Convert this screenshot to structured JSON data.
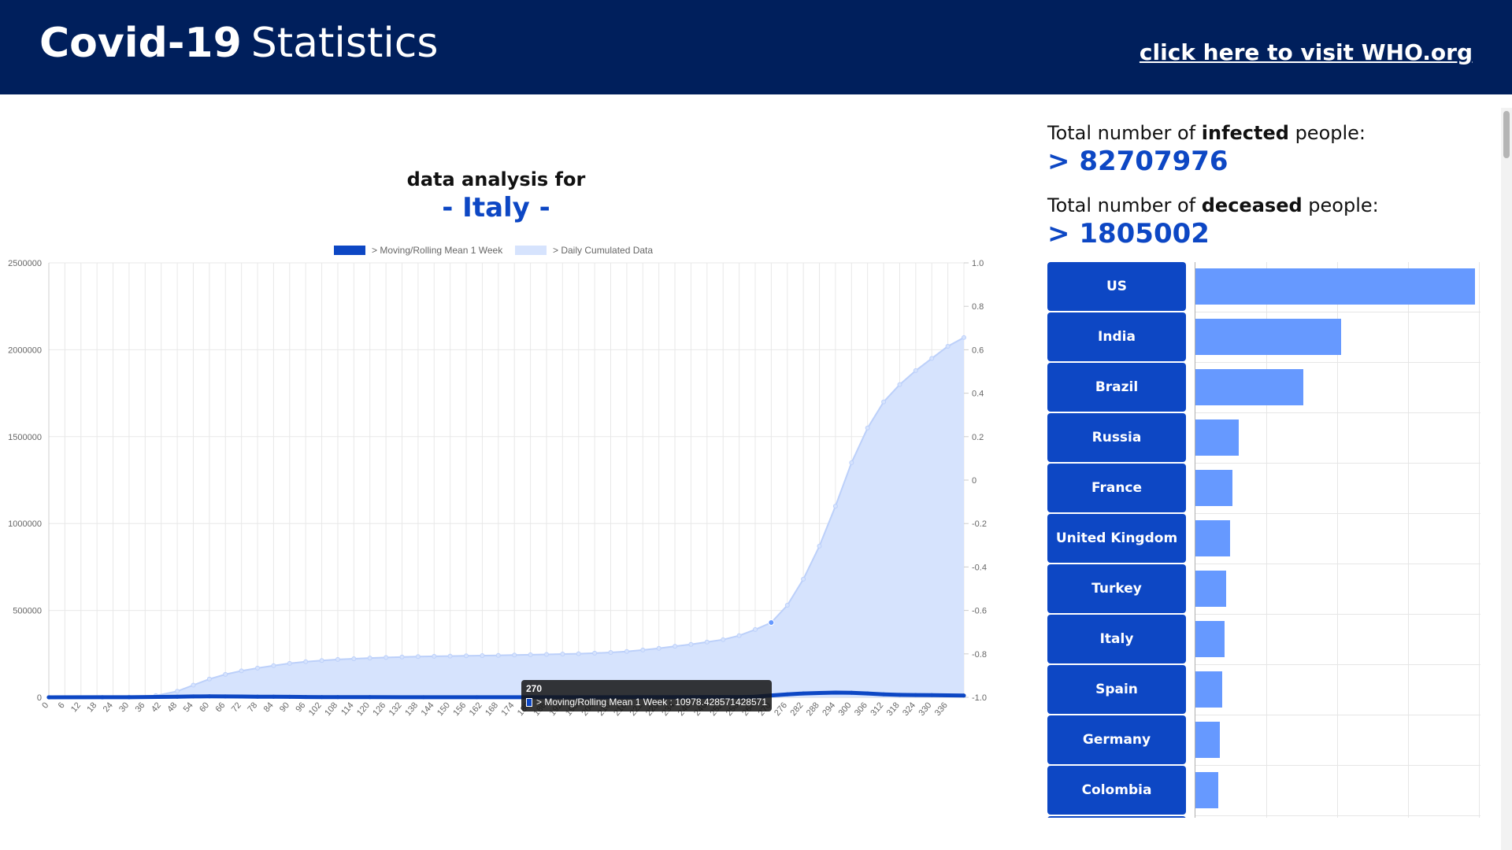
{
  "header": {
    "title_bold": "Covid-19",
    "title_light": "Statistics",
    "who_link": "click here to visit WHO.org"
  },
  "chart": {
    "heading": "data analysis for",
    "country": "- Italy -"
  },
  "stats": {
    "infected_prefix": "Total number of ",
    "infected_bold": "infected",
    "infected_suffix": " people:",
    "infected_value": "> 82707976",
    "deceased_prefix": "Total number of ",
    "deceased_bold": "deceased",
    "deceased_suffix": " people:",
    "deceased_value": "> 1805002"
  },
  "tooltip": {
    "title": "270",
    "label": "> Moving/Rolling Mean 1 Week : 10978.428571428571"
  },
  "colors": {
    "header_bg": "#001f5c",
    "accent": "#0d47c4",
    "area_fill": "#d6e3fd",
    "area_line": "#bcd0fa",
    "bar": "#6699ff"
  },
  "ranking": {
    "countries": [
      "US",
      "India",
      "Brazil",
      "Russia",
      "France",
      "United Kingdom",
      "Turkey",
      "Italy",
      "Spain",
      "Germany",
      "Colombia"
    ],
    "relative_values": [
      1.0,
      0.52,
      0.385,
      0.155,
      0.133,
      0.123,
      0.11,
      0.104,
      0.096,
      0.088,
      0.082
    ]
  },
  "chart_data": {
    "type": "line",
    "title": "data analysis for - Italy -",
    "legend": [
      "> Moving/Rolling Mean 1 Week",
      "> Daily Cumulated Data"
    ],
    "legend_position": "top",
    "xlabel": "",
    "ylabel": "",
    "ylim": [
      0,
      2500000
    ],
    "y_ticks": [
      "0",
      "500000",
      "1000000",
      "1500000",
      "2000000",
      "2500000"
    ],
    "y2_ticks": [
      "-1.0",
      "-0.8",
      "-0.6",
      "-0.4",
      "-0.2",
      "0",
      "0.2",
      "0.4",
      "0.6",
      "0.8",
      "1.0"
    ],
    "x_ticks": [
      "0",
      "6",
      "12",
      "18",
      "24",
      "30",
      "36",
      "42",
      "48",
      "54",
      "60",
      "66",
      "72",
      "78",
      "84",
      "90",
      "96",
      "102",
      "108",
      "114",
      "120",
      "126",
      "132",
      "138",
      "144",
      "150",
      "156",
      "162",
      "168",
      "174",
      "180",
      "186",
      "192",
      "198",
      "204",
      "210",
      "216",
      "222",
      "228",
      "234",
      "240",
      "246",
      "252",
      "258",
      "264",
      "270",
      "276",
      "282",
      "288",
      "294",
      "300",
      "306",
      "312",
      "318",
      "324",
      "330",
      "336"
    ],
    "xmax": 342,
    "grid": true,
    "series": [
      {
        "name": "> Daily Cumulated Data",
        "points": [
          [
            0,
            0
          ],
          [
            20,
            10
          ],
          [
            30,
            1500
          ],
          [
            40,
            10000
          ],
          [
            48,
            35000
          ],
          [
            54,
            70000
          ],
          [
            60,
            105000
          ],
          [
            66,
            132000
          ],
          [
            72,
            152000
          ],
          [
            78,
            168000
          ],
          [
            84,
            182000
          ],
          [
            90,
            195000
          ],
          [
            96,
            205000
          ],
          [
            102,
            212000
          ],
          [
            108,
            218000
          ],
          [
            114,
            222000
          ],
          [
            120,
            226000
          ],
          [
            126,
            229000
          ],
          [
            132,
            232000
          ],
          [
            138,
            234000
          ],
          [
            144,
            236000
          ],
          [
            150,
            237500
          ],
          [
            156,
            239000
          ],
          [
            162,
            240000
          ],
          [
            168,
            241500
          ],
          [
            174,
            243000
          ],
          [
            180,
            245000
          ],
          [
            186,
            247000
          ],
          [
            192,
            249000
          ],
          [
            198,
            251000
          ],
          [
            204,
            254000
          ],
          [
            210,
            258000
          ],
          [
            216,
            264000
          ],
          [
            222,
            272000
          ],
          [
            228,
            282000
          ],
          [
            234,
            294000
          ],
          [
            240,
            305000
          ],
          [
            246,
            318000
          ],
          [
            252,
            332000
          ],
          [
            258,
            355000
          ],
          [
            264,
            390000
          ],
          [
            270,
            430000
          ],
          [
            276,
            530000
          ],
          [
            282,
            680000
          ],
          [
            288,
            870000
          ],
          [
            294,
            1100000
          ],
          [
            300,
            1350000
          ],
          [
            306,
            1550000
          ],
          [
            312,
            1700000
          ],
          [
            318,
            1800000
          ],
          [
            324,
            1880000
          ],
          [
            330,
            1950000
          ],
          [
            336,
            2020000
          ],
          [
            342,
            2070000
          ]
        ]
      },
      {
        "name": "> Moving/Rolling Mean 1 Week",
        "points": [
          [
            0,
            0
          ],
          [
            30,
            500
          ],
          [
            48,
            3000
          ],
          [
            54,
            5000
          ],
          [
            60,
            5500
          ],
          [
            66,
            5000
          ],
          [
            72,
            4500
          ],
          [
            78,
            3500
          ],
          [
            84,
            3000
          ],
          [
            90,
            2500
          ],
          [
            96,
            2000
          ],
          [
            102,
            1500
          ],
          [
            108,
            1000
          ],
          [
            120,
            700
          ],
          [
            140,
            500
          ],
          [
            160,
            400
          ],
          [
            180,
            400
          ],
          [
            200,
            500
          ],
          [
            220,
            800
          ],
          [
            240,
            1200
          ],
          [
            260,
            1800
          ],
          [
            264,
            3000
          ],
          [
            270,
            10978
          ],
          [
            276,
            17000
          ],
          [
            282,
            22000
          ],
          [
            288,
            25000
          ],
          [
            294,
            27000
          ],
          [
            300,
            26000
          ],
          [
            306,
            22000
          ],
          [
            312,
            17000
          ],
          [
            318,
            14000
          ],
          [
            324,
            13000
          ],
          [
            330,
            12500
          ],
          [
            336,
            11500
          ],
          [
            342,
            10000
          ]
        ]
      }
    ]
  }
}
